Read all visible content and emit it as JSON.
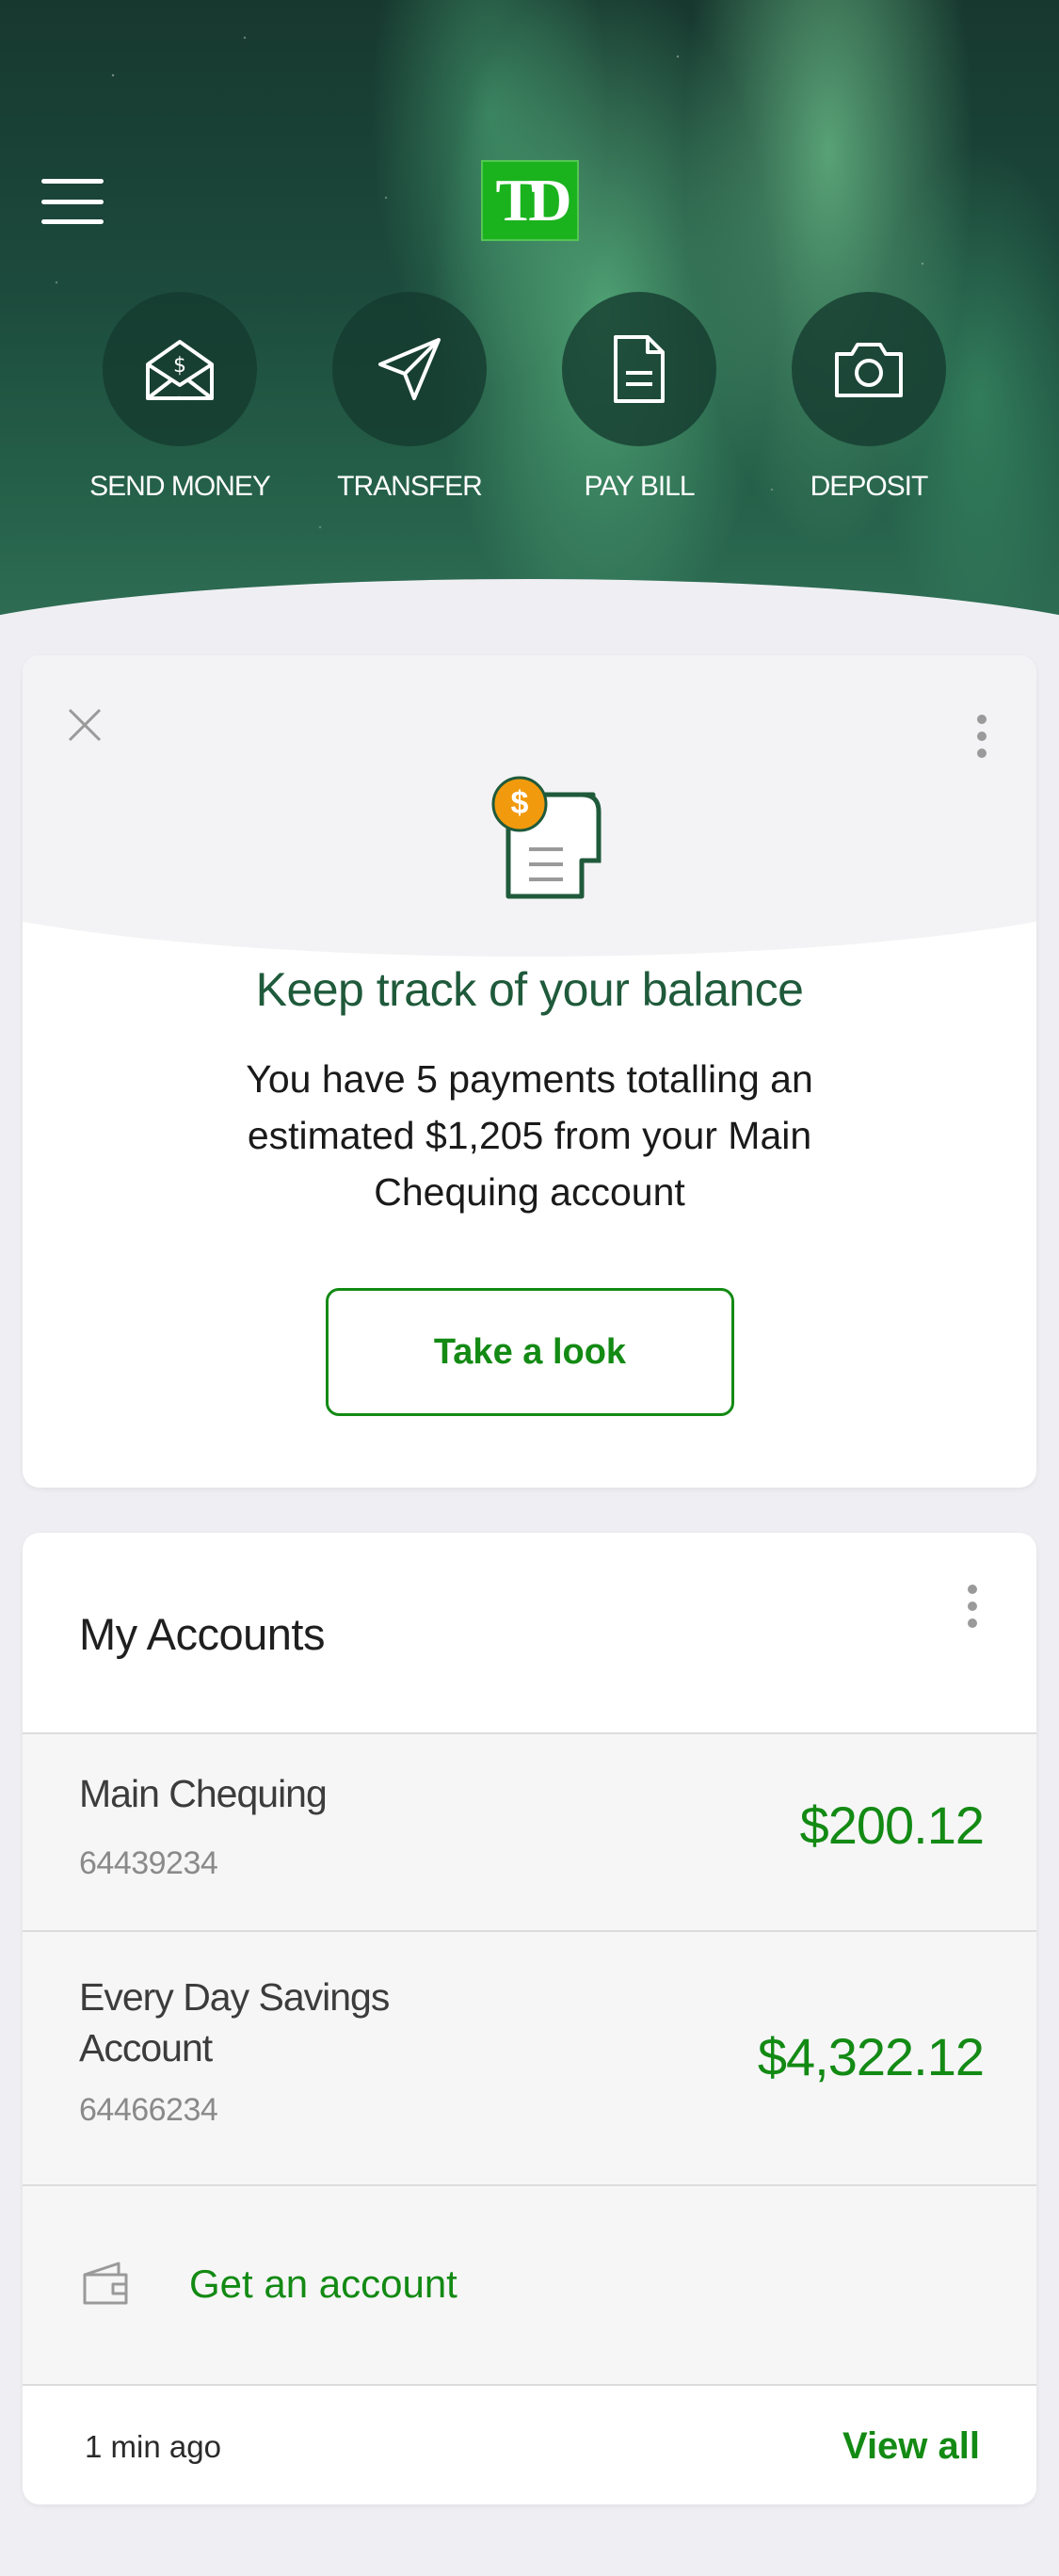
{
  "header": {
    "logo_text": "TD",
    "actions": [
      {
        "label": "SEND MONEY",
        "icon": "envelope-dollar-icon"
      },
      {
        "label": "TRANSFER",
        "icon": "paper-plane-icon"
      },
      {
        "label": "PAY BILL",
        "icon": "document-icon"
      },
      {
        "label": "DEPOSIT",
        "icon": "camera-icon"
      }
    ]
  },
  "promo": {
    "title": "Keep track of your balance",
    "text": "You have 5 payments totalling an estimated $1,205 from your Main Chequing account",
    "button_label": "Take a look",
    "icon_symbol": "$"
  },
  "accounts": {
    "title": "My Accounts",
    "items": [
      {
        "name": "Main Chequing",
        "number": "64439234",
        "balance": "$200.12"
      },
      {
        "name": "Every Day Savings Account",
        "number": "64466234",
        "balance": "$4,322.12"
      }
    ],
    "get_account_label": "Get an account",
    "updated": "1 min ago",
    "view_all_label": "View all"
  },
  "colors": {
    "brand_green": "#138a14",
    "logo_green": "#1ab31d",
    "title_green": "#1f5a3b",
    "coin_orange": "#f29a0d"
  }
}
